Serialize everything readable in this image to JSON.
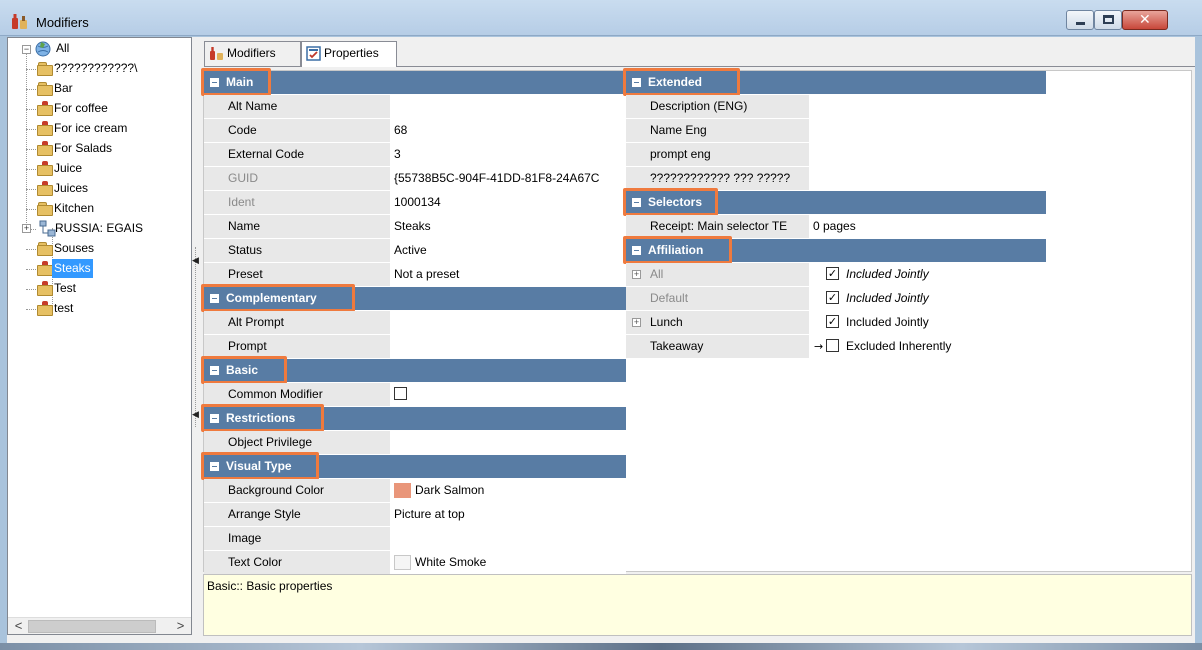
{
  "window": {
    "title": "Modifiers"
  },
  "tree": {
    "root": "All",
    "items": [
      {
        "label": "????????????\\",
        "icon": "folder-plain"
      },
      {
        "label": "Bar",
        "icon": "folder-plain"
      },
      {
        "label": "For coffee",
        "icon": "folder-bottle"
      },
      {
        "label": "For ice cream",
        "icon": "folder-bottle"
      },
      {
        "label": "For Salads",
        "icon": "folder-bottle"
      },
      {
        "label": "Juice",
        "icon": "folder-bottle"
      },
      {
        "label": "Juices",
        "icon": "folder-bottle"
      },
      {
        "label": "Kitchen",
        "icon": "folder-plain"
      },
      {
        "label": "RUSSIA: EGAIS",
        "icon": "network"
      },
      {
        "label": "Souses",
        "icon": "folder-plain"
      },
      {
        "label": "Steaks",
        "icon": "folder-bottle",
        "selected": true
      },
      {
        "label": "Test",
        "icon": "folder-bottle"
      },
      {
        "label": "test",
        "icon": "folder-bottle"
      }
    ]
  },
  "tabs": [
    {
      "label": "Modifiers",
      "active": false
    },
    {
      "label": "Properties",
      "active": true
    }
  ],
  "left_column": {
    "main": {
      "title": "Main",
      "rows": [
        {
          "name": "Alt Name",
          "value": ""
        },
        {
          "name": "Code",
          "value": "68"
        },
        {
          "name": "External Code",
          "value": "3"
        },
        {
          "name": "GUID",
          "value": "{55738B5C-904F-41DD-81F8-24A67C",
          "disabled": true
        },
        {
          "name": "Ident",
          "value": "1000134",
          "disabled": true
        },
        {
          "name": "Name",
          "value": "Steaks"
        },
        {
          "name": "Status",
          "value": "Active"
        },
        {
          "name": "Preset",
          "value": "Not a preset"
        }
      ]
    },
    "complementary": {
      "title": "Complementary",
      "rows": [
        {
          "name": "Alt Prompt",
          "value": ""
        },
        {
          "name": "Prompt",
          "value": ""
        }
      ]
    },
    "basic": {
      "title": "Basic",
      "rows": [
        {
          "name": "Common Modifier",
          "checked": false
        }
      ]
    },
    "restrictions": {
      "title": "Restrictions",
      "rows": [
        {
          "name": "Object Privilege",
          "value": ""
        }
      ]
    },
    "visual_type": {
      "title": "Visual Type",
      "rows": [
        {
          "name": "Background Color",
          "value": "Dark Salmon",
          "swatch": "#e9967a"
        },
        {
          "name": "Arrange Style",
          "value": "Picture at top"
        },
        {
          "name": "Image",
          "value": ""
        },
        {
          "name": "Text Color",
          "value": "White Smoke",
          "swatch": "#f5f5f5"
        }
      ]
    }
  },
  "right_column": {
    "extended": {
      "title": "Extended",
      "rows": [
        {
          "name": "Description (ENG)",
          "value": ""
        },
        {
          "name": "Name Eng",
          "value": ""
        },
        {
          "name": "prompt eng",
          "value": ""
        },
        {
          "name": "???????????? ??? ?????",
          "value": ""
        }
      ]
    },
    "selectors": {
      "title": "Selectors",
      "rows": [
        {
          "name": "Receipt: Main selector TE",
          "value": "0 pages"
        }
      ]
    },
    "affiliation": {
      "title": "Affiliation",
      "rows": [
        {
          "name": "All",
          "value": "Included Jointly",
          "checked": true,
          "expandable": true,
          "disabled": true,
          "italic": true
        },
        {
          "name": "Default",
          "value": "Included Jointly",
          "checked": true,
          "disabled": true,
          "italic": true
        },
        {
          "name": "Lunch",
          "value": "Included Jointly",
          "checked": true,
          "expandable": true
        },
        {
          "name": "Takeaway",
          "value": "Excluded Inherently",
          "checked": false,
          "arrow": "→"
        }
      ]
    }
  },
  "description": "Basic:: Basic properties",
  "colors": {
    "category_header": "#587ca4",
    "highlight": "#ef7a3e",
    "selection": "#3399ff",
    "description_bg": "#ffffe1"
  }
}
